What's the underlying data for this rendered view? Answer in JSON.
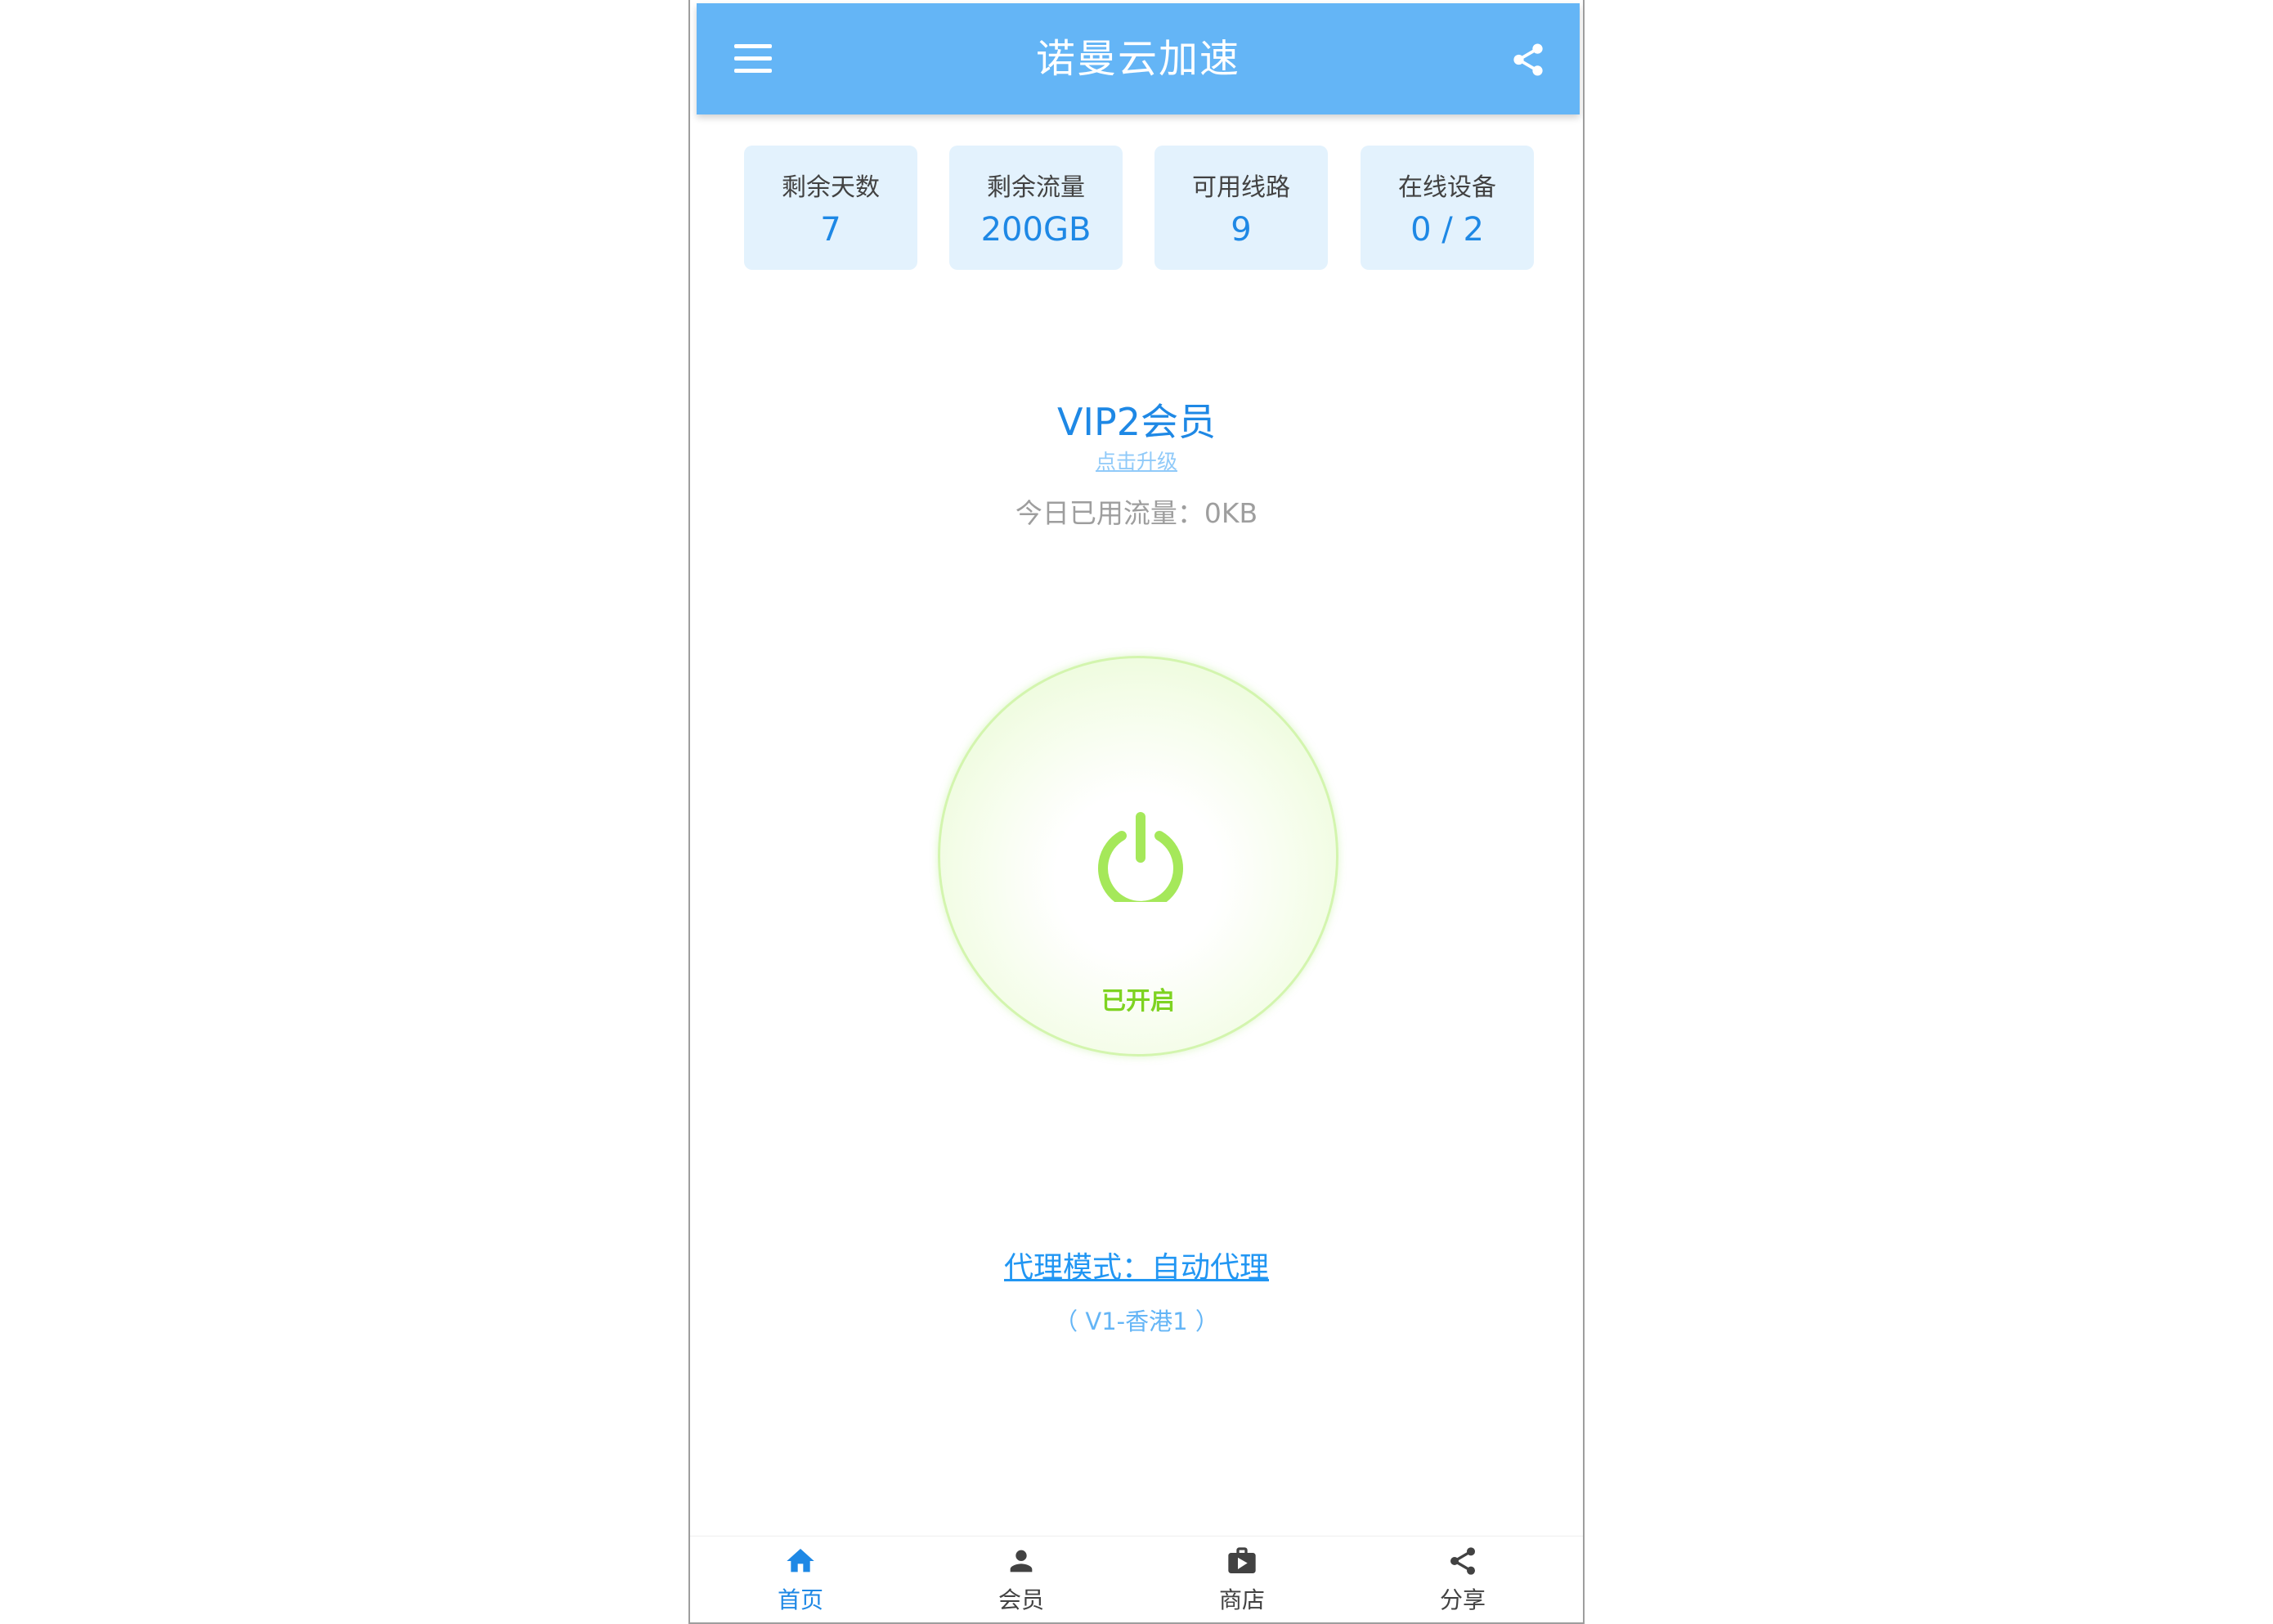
{
  "app": {
    "title": "诺曼云加速"
  },
  "stats": [
    {
      "label": "剩余天数",
      "value": "7"
    },
    {
      "label": "剩余流量",
      "value": "200GB"
    },
    {
      "label": "可用线路",
      "value": "9"
    },
    {
      "label": "在线设备",
      "value": "0 / 2"
    }
  ],
  "member": {
    "level": "VIP2会员",
    "upgrade_link": "点击升级",
    "today_usage": "今日已用流量：0KB"
  },
  "power": {
    "state": "已开启",
    "icon": "power-icon"
  },
  "mode": {
    "proxy_mode": "代理模式：自动代理",
    "node": "（ V1-香港1 ）"
  },
  "nav": [
    {
      "label": "首页",
      "icon": "home-icon",
      "active": true
    },
    {
      "label": "会员",
      "icon": "person-icon"
    },
    {
      "label": "商店",
      "icon": "store-icon"
    },
    {
      "label": "分享",
      "icon": "share-icon"
    }
  ],
  "colors": {
    "header": "#64b5f6",
    "accent": "#1e88e5",
    "card_bg": "#e3f2fd",
    "power_on": "#a5e85a"
  }
}
